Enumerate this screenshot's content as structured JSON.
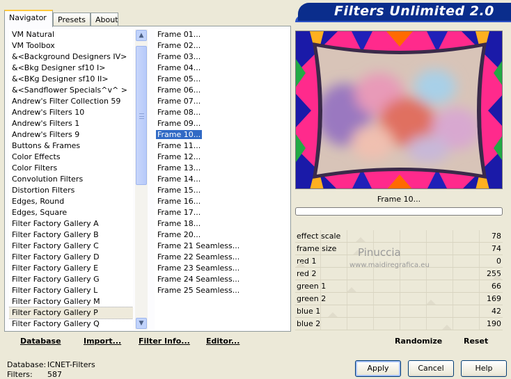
{
  "tabs": {
    "navigator": "Navigator",
    "presets": "Presets",
    "about": "About"
  },
  "app_title": "Filters Unlimited 2.0",
  "categories": [
    "VM Natural",
    "VM Toolbox",
    "&<Background Designers IV>",
    "&<Bkg Designer sf10 I>",
    "&<BKg Designer sf10 II>",
    "&<Sandflower Specials^v^ >",
    "Andrew's Filter Collection 59",
    "Andrew's Filters 10",
    "Andrew's Filters 1",
    "Andrew's Filters 9",
    "Buttons & Frames",
    "Color Effects",
    "Color Filters",
    "Convolution Filters",
    "Distortion Filters",
    "Edges, Round",
    "Edges, Square",
    "Filter Factory Gallery A",
    "Filter Factory Gallery B",
    "Filter Factory Gallery C",
    "Filter Factory Gallery D",
    "Filter Factory Gallery E",
    "Filter Factory Gallery G",
    "Filter Factory Gallery L",
    "Filter Factory Gallery M",
    "Filter Factory Gallery P",
    "Filter Factory Gallery Q"
  ],
  "highlighted_category": "Filter Factory Gallery P",
  "filters": [
    "Frame 01...",
    "Frame 02...",
    "Frame 03...",
    "Frame 04...",
    "Frame 05...",
    "Frame 06...",
    "Frame 07...",
    "Frame 08...",
    "Frame 09...",
    "Frame 10...",
    "Frame 11...",
    "Frame 12...",
    "Frame 13...",
    "Frame 14...",
    "Frame 15...",
    "Frame 16...",
    "Frame 17...",
    "Frame 18...",
    "Frame 20...",
    "Frame 21 Seamless...",
    "Frame 22 Seamless...",
    "Frame 23 Seamless...",
    "Frame 24 Seamless...",
    "Frame 25 Seamless..."
  ],
  "selected_filter": "Frame 10...",
  "bottom_left": {
    "database": "Database",
    "import": "Import...",
    "filter_info": "Filter Info...",
    "editor": "Editor..."
  },
  "preview_label": "Frame 10...",
  "progress": 0,
  "watermark": {
    "name": "Pinuccia",
    "url": "www.maidiregrafica.eu"
  },
  "parameters": [
    {
      "name": "effect scale",
      "value": 78
    },
    {
      "name": "frame size",
      "value": 74
    },
    {
      "name": "red 1",
      "value": 0
    },
    {
      "name": "red 2",
      "value": 255
    },
    {
      "name": "green 1",
      "value": 66
    },
    {
      "name": "green 2",
      "value": 169
    },
    {
      "name": "blue 1",
      "value": 42
    },
    {
      "name": "blue 2",
      "value": 190
    }
  ],
  "right_bottom": {
    "randomize": "Randomize",
    "reset": "Reset"
  },
  "status": {
    "database_label": "Database:",
    "database_value": "ICNET-Filters",
    "filters_label": "Filters:",
    "filters_value": "587"
  },
  "buttons": {
    "apply": "Apply",
    "cancel": "Cancel",
    "help": "Help"
  },
  "colors": {
    "title_bg": "#0a2d8c",
    "selection": "#316ac5",
    "window_bg": "#ece9d8"
  }
}
